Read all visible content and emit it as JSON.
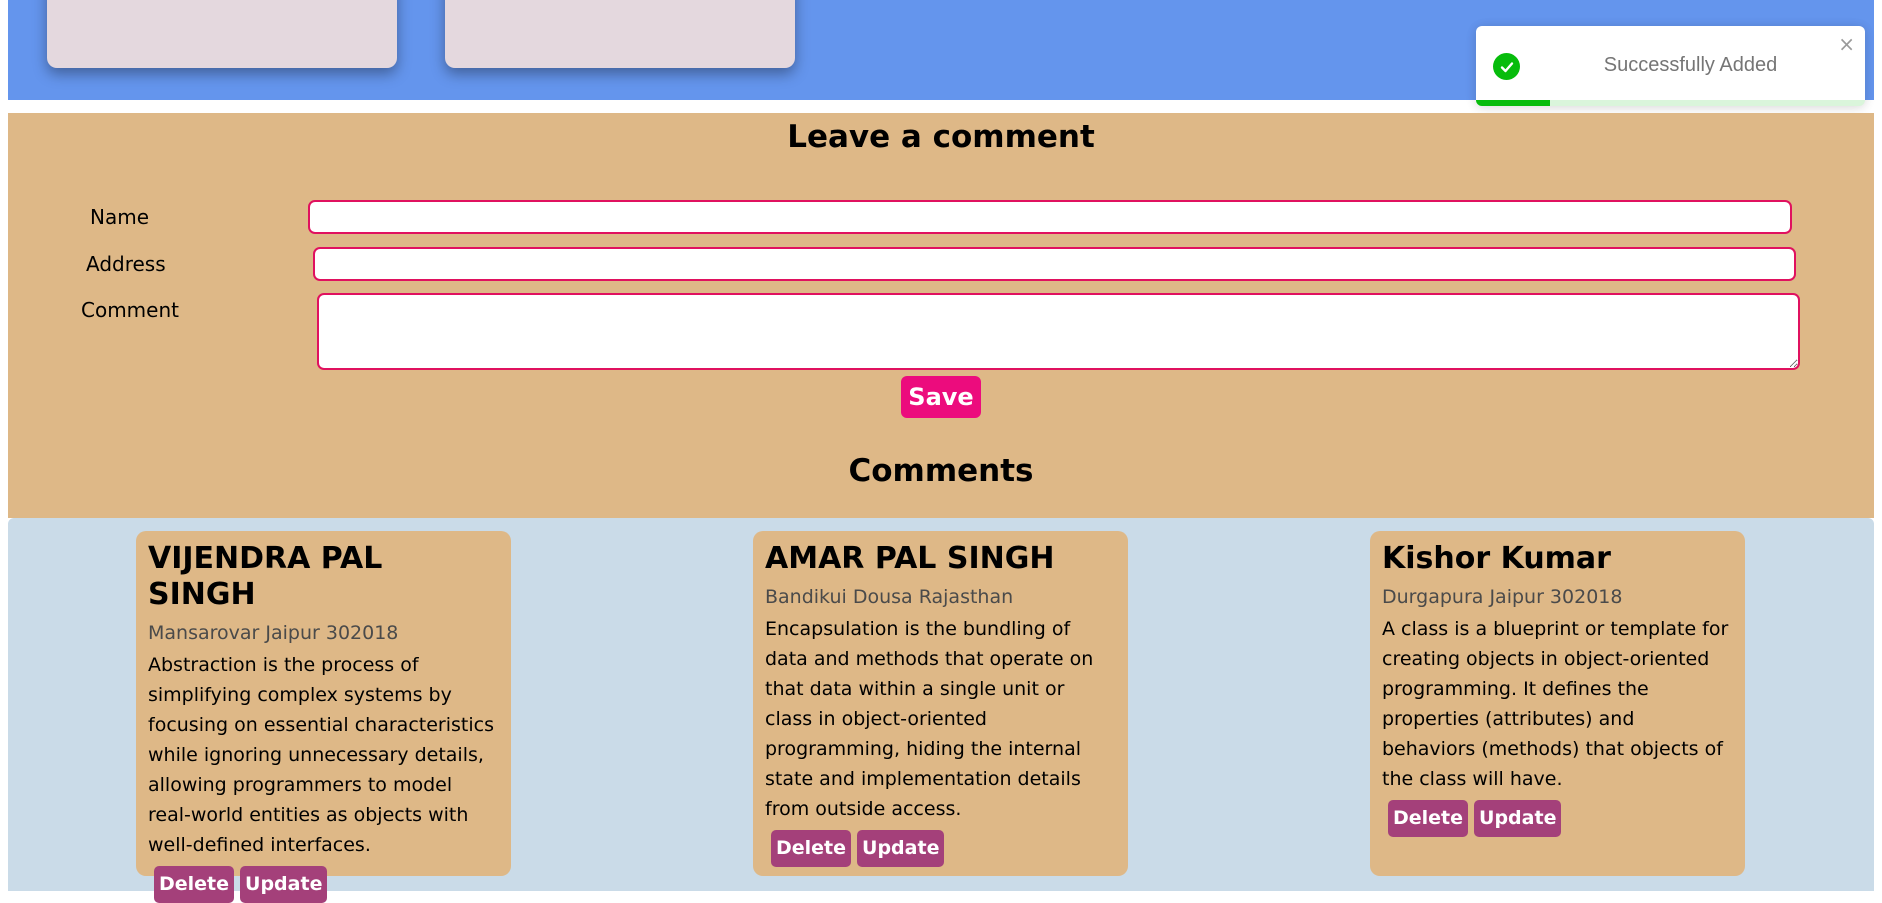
{
  "toast": {
    "message": "Successfully Added",
    "close_glyph": "×",
    "status_color": "#07bc0c",
    "progress": 0.19
  },
  "form": {
    "title": "Leave a comment",
    "name_label": "Name",
    "name_value": "",
    "address_label": "Address",
    "address_value": "",
    "comment_label": "Comment",
    "comment_value": "",
    "save_label": "Save"
  },
  "comments": {
    "title": "Comments",
    "items": [
      {
        "name": "VIJENDRA PAL SINGH",
        "address": "Mansarovar Jaipur 302018",
        "text": "Abstraction is the process of simplifying complex systems by focusing on essential characteristics while ignoring unnecessary details, allowing programmers to model real-world entities as objects with well-defined interfaces.",
        "delete_label": "Delete",
        "update_label": "Update"
      },
      {
        "name": "AMAR PAL SINGH",
        "address": "Bandikui Dousa Rajasthan",
        "text": "Encapsulation is the bundling of data and methods that operate on that data within a single unit or class in object-oriented programming, hiding the internal state and implementation details from outside access.",
        "delete_label": "Delete",
        "update_label": "Update"
      },
      {
        "name": "Kishor Kumar",
        "address": "Durgapura Jaipur 302018",
        "text": "A class is a blueprint or template for creating objects in object-oriented programming. It defines the properties (attributes) and behaviors (methods) that objects of the class will have.",
        "delete_label": "Delete",
        "update_label": "Update"
      }
    ]
  },
  "colors": {
    "banner": "#6495ed",
    "form_bg": "#deb887",
    "list_bg": "#cadbe8",
    "accent": "#ec0c7d",
    "card_button": "#a4407a"
  }
}
